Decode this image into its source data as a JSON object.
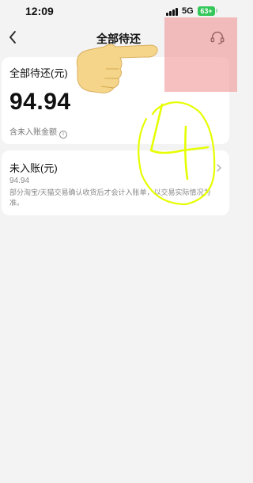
{
  "status_bar": {
    "time": "12:09",
    "network": "5G",
    "battery": "63+"
  },
  "nav": {
    "title": "全部待还",
    "back_icon": "chevron-left-icon",
    "service_icon": "customer-service-icon"
  },
  "total_card": {
    "label": "全部待还(元)",
    "amount": "94.94",
    "note": "含未入账金额"
  },
  "pending_card": {
    "label": "未入账(元)",
    "amount": "94.94",
    "description": "部分淘宝/天猫交易确认收货后才会计入账单，以交易实际情况为准。"
  },
  "annotations": {
    "handwritten_number": "4",
    "overlay_color": "#f08c8c",
    "scribble_color": "#e6ff00"
  }
}
